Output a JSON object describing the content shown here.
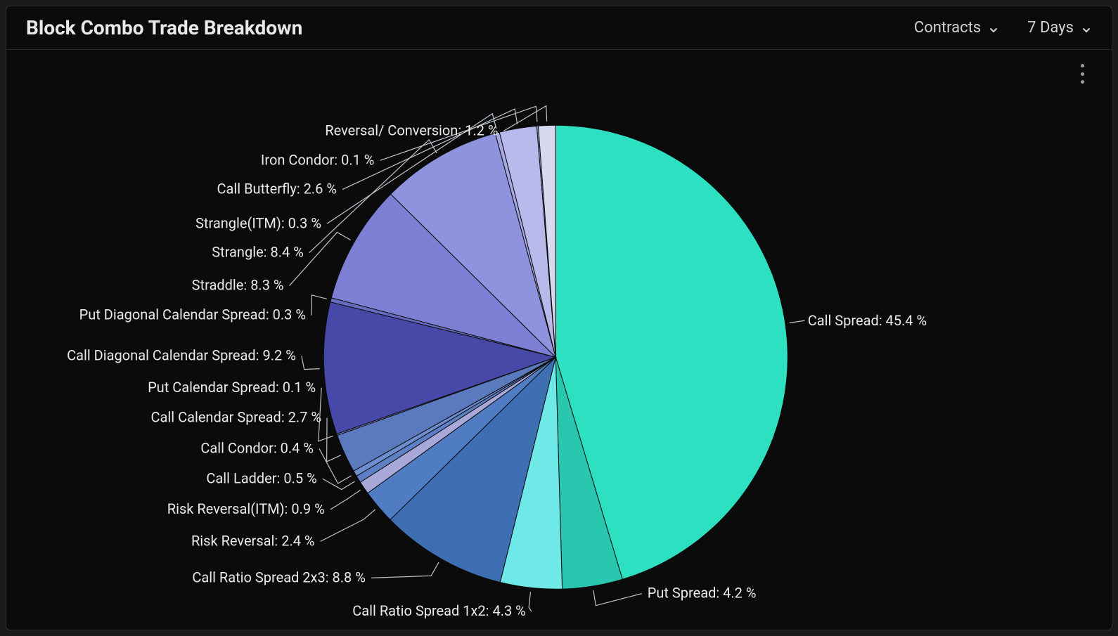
{
  "header": {
    "title": "Block Combo Trade Breakdown",
    "mode_dropdown": "Contracts",
    "range_dropdown": "7 Days"
  },
  "chart_data": {
    "type": "pie",
    "title": "Block Combo Trade Breakdown",
    "series": [
      {
        "name": "Call Spread",
        "value": 45.4,
        "color": "#2ee0c2"
      },
      {
        "name": "Put Spread",
        "value": 4.2,
        "color": "#29c7b0"
      },
      {
        "name": "Call Ratio Spread 1x2",
        "value": 4.3,
        "color": "#6fe9e7"
      },
      {
        "name": "Call Ratio Spread 2x3",
        "value": 8.8,
        "color": "#3e6fb3"
      },
      {
        "name": "Risk Reversal",
        "value": 2.4,
        "color": "#4f7cc2"
      },
      {
        "name": "Risk Reversal(ITM)",
        "value": 0.9,
        "color": "#a8a9d9"
      },
      {
        "name": "Call Ladder",
        "value": 0.5,
        "color": "#5c7fc6"
      },
      {
        "name": "Call Condor",
        "value": 0.4,
        "color": "#6f8ed0"
      },
      {
        "name": "Call Calendar Spread",
        "value": 2.7,
        "color": "#5b79bd"
      },
      {
        "name": "Put Calendar Spread",
        "value": 0.1,
        "color": "#7d90c9"
      },
      {
        "name": "Call Diagonal Calendar Spread",
        "value": 9.2,
        "color": "#4748a8"
      },
      {
        "name": "Put Diagonal Calendar Spread",
        "value": 0.3,
        "color": "#686cc0"
      },
      {
        "name": "Straddle",
        "value": 8.3,
        "color": "#7d7fd4"
      },
      {
        "name": "Strangle",
        "value": 8.4,
        "color": "#8f92dd"
      },
      {
        "name": "Strangle(ITM)",
        "value": 0.3,
        "color": "#a6a9e4"
      },
      {
        "name": "Call Butterfly",
        "value": 2.6,
        "color": "#b6b9ea"
      },
      {
        "name": "Iron Condor",
        "value": 0.1,
        "color": "#9ea2df"
      },
      {
        "name": "Reversal/ Conversion",
        "value": 1.2,
        "color": "#d7d9ee"
      }
    ]
  }
}
